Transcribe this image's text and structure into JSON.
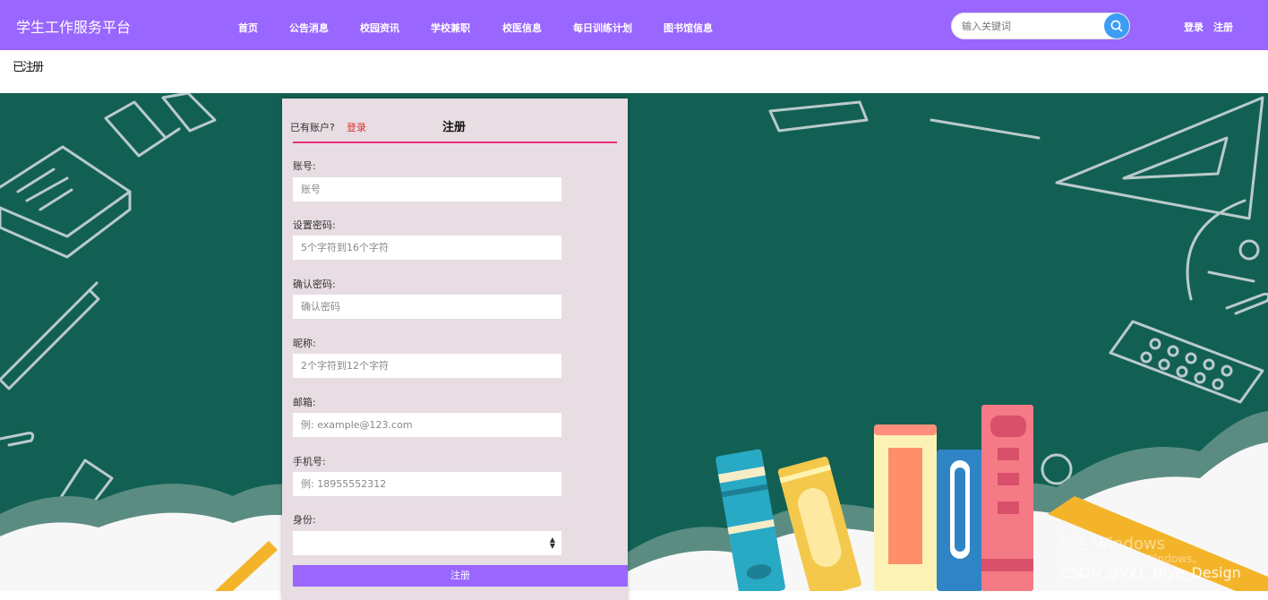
{
  "header": {
    "brand": "学生工作服务平台",
    "nav": [
      "首页",
      "公告消息",
      "校园资讯",
      "学校兼职",
      "校医信息",
      "每日训练计划",
      "图书馆信息"
    ],
    "search": {
      "placeholder": "输入关键词",
      "icon": "search-icon"
    },
    "login_label": "登录",
    "register_label": "注册"
  },
  "breadcrumb": "已注册",
  "form": {
    "has_account": "已有账户?",
    "login_link": "登录",
    "title": "注册",
    "fields": [
      {
        "label": "账号:",
        "placeholder": "账号"
      },
      {
        "label": "设置密码:",
        "placeholder": "5个字符到16个字符"
      },
      {
        "label": "确认密码:",
        "placeholder": "确认密码"
      },
      {
        "label": "昵称:",
        "placeholder": "2个字符到12个字符"
      },
      {
        "label": "邮箱:",
        "placeholder": "例: example@123.com"
      },
      {
        "label": "手机号:",
        "placeholder": "例: 18955552312"
      }
    ],
    "identity": {
      "label": "身份:",
      "value": ""
    },
    "submit_label": "注册"
  },
  "watermark": {
    "activate_title": "激活 Windows",
    "activate_hint": "转到\"设置\"以激活 Windows。",
    "csdn": "CSDN @vx1_Biye_Design"
  },
  "colors": {
    "accent": "#9966ff",
    "chalkboard": "#126054",
    "form_bg": "#e7dde3",
    "link_red": "#e0302d",
    "divider_pink": "#e8307a",
    "search_button": "#3d9df5"
  }
}
